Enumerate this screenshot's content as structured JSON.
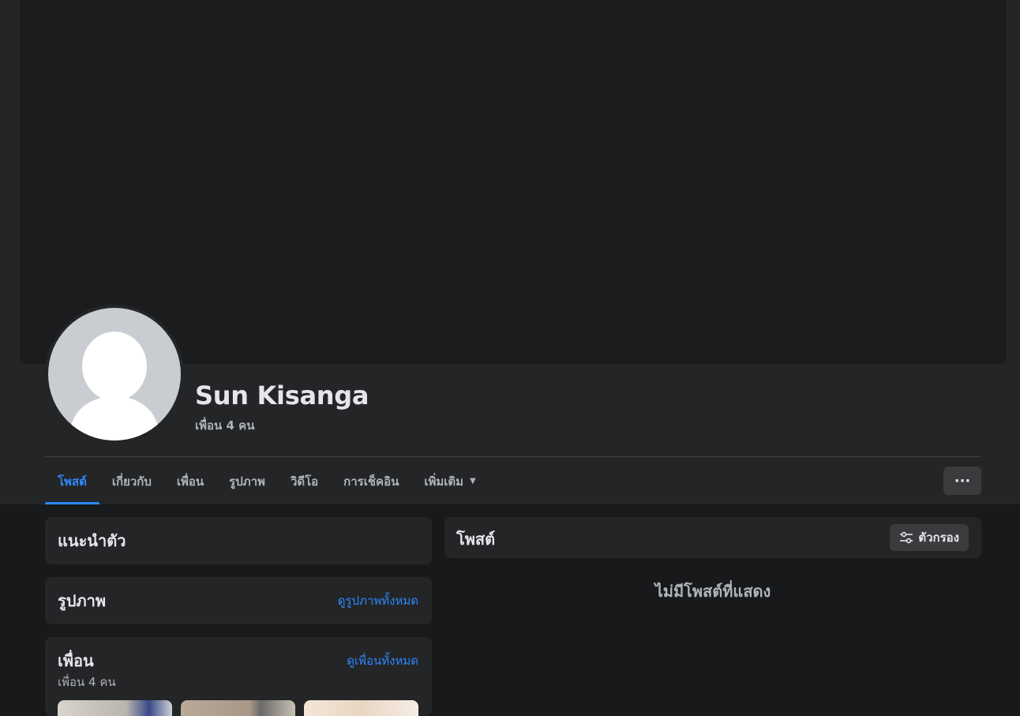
{
  "profile": {
    "name": "Sun Kisanga",
    "friend_count": "เพื่อน 4 คน"
  },
  "tabs": [
    {
      "label": "โพสต์",
      "active": true
    },
    {
      "label": "เกี่ยวกับ"
    },
    {
      "label": "เพื่อน"
    },
    {
      "label": "รูปภาพ"
    },
    {
      "label": "วิดีโอ"
    },
    {
      "label": "การเช็คอิน"
    },
    {
      "label": "เพิ่มเติม"
    }
  ],
  "more_button_label": "···",
  "intro": {
    "title": "แนะนำตัว"
  },
  "photos": {
    "title": "รูปภาพ",
    "link": "ดูรูปภาพทั้งหมด"
  },
  "friends": {
    "title": "เพื่อน",
    "subtitle": "เพื่อน 4 คน",
    "link": "ดูเพื่อนทั้งหมด"
  },
  "posts": {
    "title": "โพสต์",
    "filter_label": "ตัวกรอง",
    "empty_text": "ไม่มีโพสต์ที่แสดง"
  },
  "colors": {
    "accent": "#2d88ff",
    "background": "#18191a",
    "card": "#242526"
  }
}
